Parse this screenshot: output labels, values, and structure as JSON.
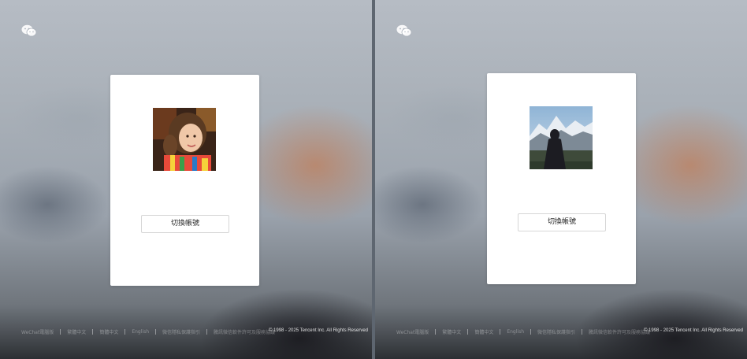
{
  "panels": [
    {
      "switch_label": "切換帳號",
      "avatar_desc": "child-photo",
      "footer": {
        "links": [
          "WeChat電腦版",
          "繁體中文",
          "簡體中文",
          "English",
          "微信隱私保護指引",
          "騰訊微信軟件許可及服務協議"
        ],
        "copyright": "© 1998 - 2025 Tencent Inc. All Rights Reserved"
      }
    },
    {
      "switch_label": "切換帳號",
      "avatar_desc": "mountain-photo",
      "footer": {
        "links": [
          "WeChat電腦版",
          "繁體中文",
          "簡體中文",
          "English",
          "微信隱私保護指引",
          "騰訊微信軟件許可及服務協議"
        ],
        "copyright": "© 1998 - 2025 Tencent Inc. All Rights Reserved"
      }
    }
  ],
  "icons": {
    "logo": "wechat-logo-icon"
  }
}
